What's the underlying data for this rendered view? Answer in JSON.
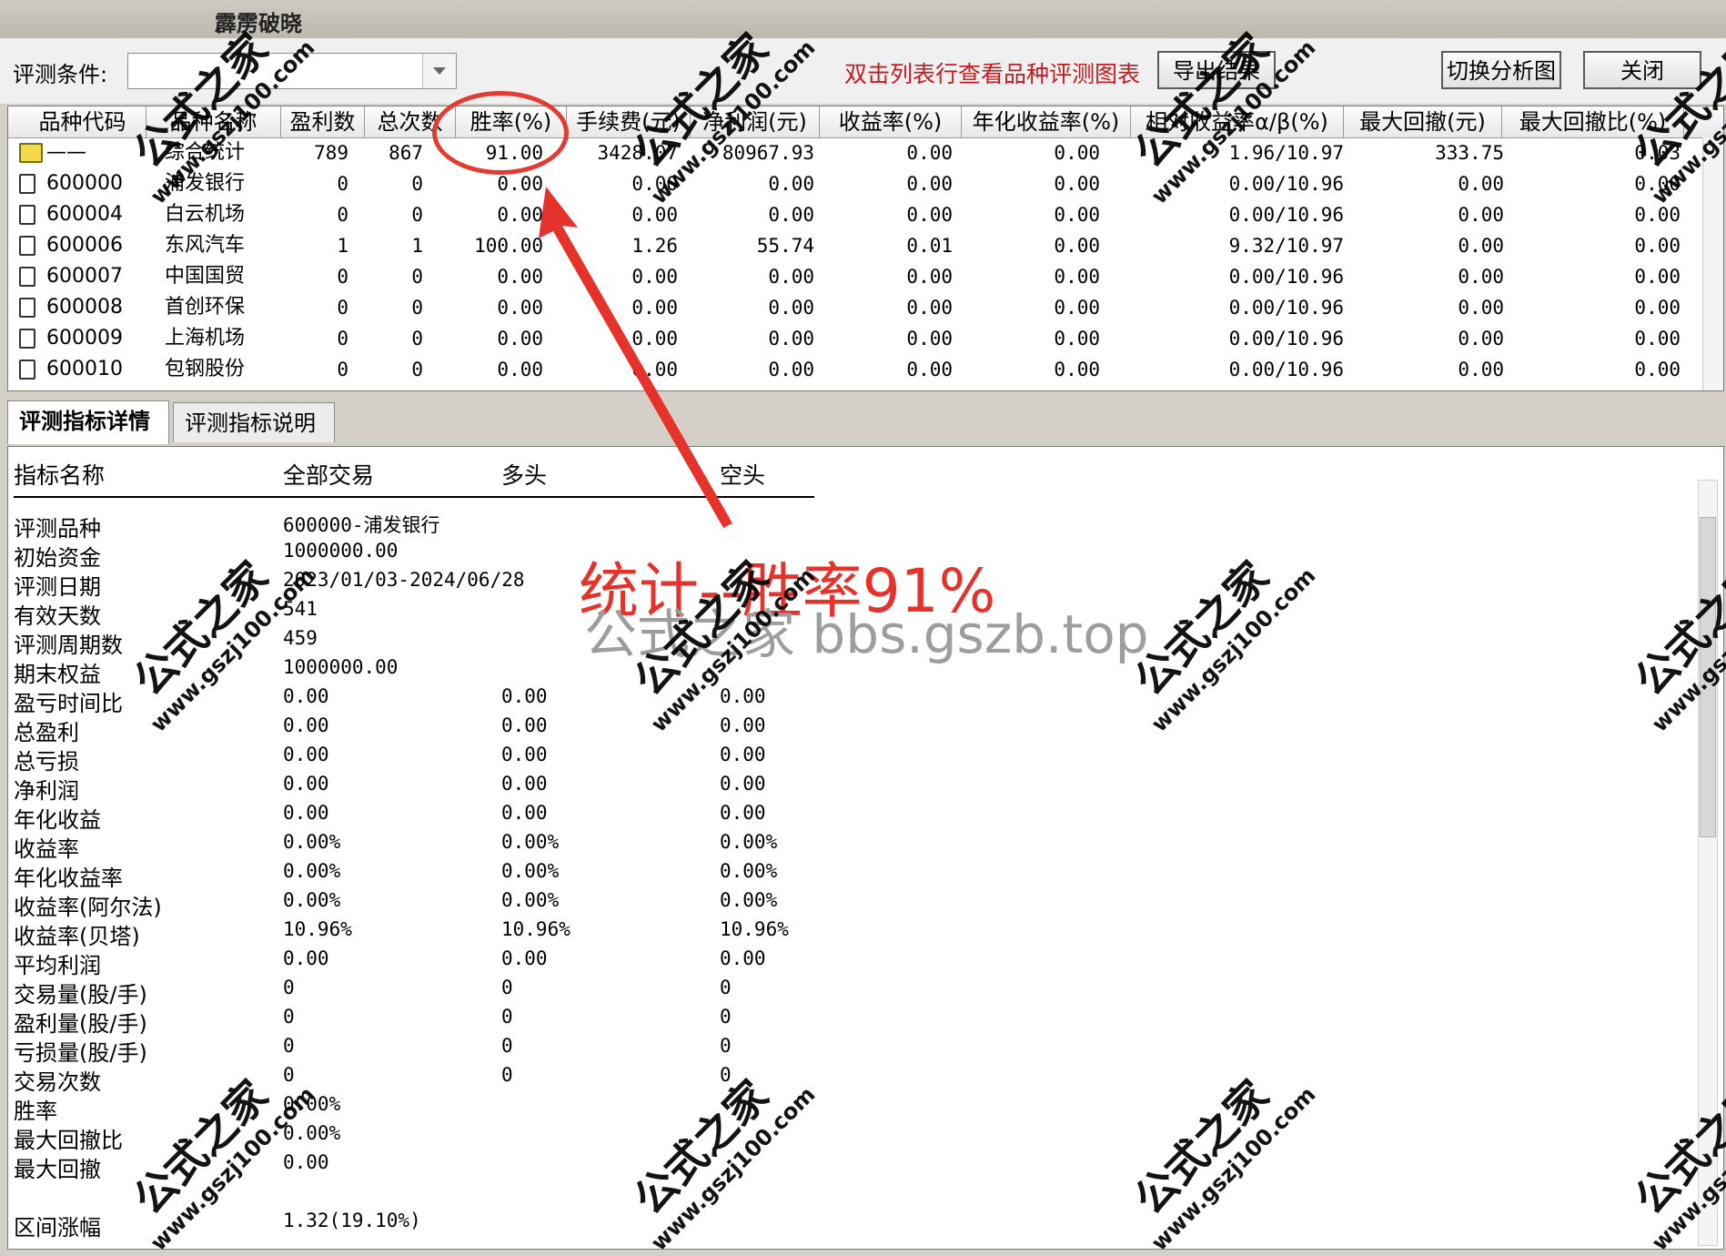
{
  "window": {
    "title": "霹雳破晓"
  },
  "toolbar": {
    "condition_label": "评测条件:",
    "condition_value": "",
    "hint": "双击列表行查看品种评测图表",
    "export_label": "导出结果",
    "switch_label": "切换分析图",
    "close_label": "关闭"
  },
  "grid": {
    "columns": [
      "品种代码",
      "品种名称",
      "盈利数",
      "总次数",
      "胜率(%)",
      "手续费(元)",
      "净利润(元)",
      "收益率(%)",
      "年化收益率(%)",
      "相对收益率α/β(%)",
      "最大回撤(元)",
      "最大回撤比(%)"
    ],
    "rows": [
      {
        "code": "——",
        "name": "综合统计",
        "win": "789",
        "total": "867",
        "rate": "91.00",
        "fee": "3428.07",
        "profit": "80967.93",
        "ret": "0.00",
        "annual": "0.00",
        "rel": "1.96/10.97",
        "dd": "333.75",
        "ddr": "0.03"
      },
      {
        "code": "600000",
        "name": "浦发银行",
        "win": "0",
        "total": "0",
        "rate": "0.00",
        "fee": "0.00",
        "profit": "0.00",
        "ret": "0.00",
        "annual": "0.00",
        "rel": "0.00/10.96",
        "dd": "0.00",
        "ddr": "0.00"
      },
      {
        "code": "600004",
        "name": "白云机场",
        "win": "0",
        "total": "0",
        "rate": "0.00",
        "fee": "0.00",
        "profit": "0.00",
        "ret": "0.00",
        "annual": "0.00",
        "rel": "0.00/10.96",
        "dd": "0.00",
        "ddr": "0.00"
      },
      {
        "code": "600006",
        "name": "东风汽车",
        "win": "1",
        "total": "1",
        "rate": "100.00",
        "fee": "1.26",
        "profit": "55.74",
        "ret": "0.01",
        "annual": "0.00",
        "rel": "9.32/10.97",
        "dd": "0.00",
        "ddr": "0.00"
      },
      {
        "code": "600007",
        "name": "中国国贸",
        "win": "0",
        "total": "0",
        "rate": "0.00",
        "fee": "0.00",
        "profit": "0.00",
        "ret": "0.00",
        "annual": "0.00",
        "rel": "0.00/10.96",
        "dd": "0.00",
        "ddr": "0.00"
      },
      {
        "code": "600008",
        "name": "首创环保",
        "win": "0",
        "total": "0",
        "rate": "0.00",
        "fee": "0.00",
        "profit": "0.00",
        "ret": "0.00",
        "annual": "0.00",
        "rel": "0.00/10.96",
        "dd": "0.00",
        "ddr": "0.00"
      },
      {
        "code": "600009",
        "name": "上海机场",
        "win": "0",
        "total": "0",
        "rate": "0.00",
        "fee": "0.00",
        "profit": "0.00",
        "ret": "0.00",
        "annual": "0.00",
        "rel": "0.00/10.96",
        "dd": "0.00",
        "ddr": "0.00"
      },
      {
        "code": "600010",
        "name": "包钢股份",
        "win": "0",
        "total": "0",
        "rate": "0.00",
        "fee": "0.00",
        "profit": "0.00",
        "ret": "0.00",
        "annual": "0.00",
        "rel": "0.00/10.96",
        "dd": "0.00",
        "ddr": "0.00"
      }
    ]
  },
  "tabs": [
    "评测指标详情",
    "评测指标说明"
  ],
  "detail": {
    "headers": [
      "指标名称",
      "全部交易",
      "多头",
      "空头"
    ],
    "rows": [
      [
        "评测品种",
        "600000-浦发银行",
        "",
        ""
      ],
      [
        "初始资金",
        "1000000.00",
        "",
        ""
      ],
      [
        "评测日期",
        "2023/01/03-2024/06/28",
        "",
        ""
      ],
      [
        "有效天数",
        "541",
        "",
        ""
      ],
      [
        "评测周期数",
        "459",
        "",
        ""
      ],
      [
        "期末权益",
        "1000000.00",
        "",
        ""
      ],
      [
        "盈亏时间比",
        "0.00",
        "0.00",
        "0.00"
      ],
      [
        "总盈利",
        "0.00",
        "0.00",
        "0.00"
      ],
      [
        "总亏损",
        "0.00",
        "0.00",
        "0.00"
      ],
      [
        "净利润",
        "0.00",
        "0.00",
        "0.00"
      ],
      [
        "年化收益",
        "0.00",
        "0.00",
        "0.00"
      ],
      [
        "收益率",
        "0.00%",
        "0.00%",
        "0.00%"
      ],
      [
        "年化收益率",
        "0.00%",
        "0.00%",
        "0.00%"
      ],
      [
        "收益率(阿尔法)",
        "0.00%",
        "0.00%",
        "0.00%"
      ],
      [
        "收益率(贝塔)",
        "10.96%",
        "10.96%",
        "10.96%"
      ],
      [
        "平均利润",
        "0.00",
        "0.00",
        "0.00"
      ],
      [
        "交易量(股/手)",
        "0",
        "0",
        "0"
      ],
      [
        "盈利量(股/手)",
        "0",
        "0",
        "0"
      ],
      [
        "亏损量(股/手)",
        "0",
        "0",
        "0"
      ],
      [
        "交易次数",
        "0",
        "0",
        "0"
      ],
      [
        "胜率",
        "0.00%",
        "",
        ""
      ],
      [
        "最大回撤比",
        "0.00%",
        "",
        ""
      ],
      [
        "最大回撤",
        "0.00",
        "",
        ""
      ],
      [
        "",
        "",
        " ",
        ""
      ],
      [
        "区间涨幅",
        "1.32(19.10%)",
        "",
        ""
      ]
    ]
  },
  "annotation": {
    "text": "统计--胜率91%",
    "sub": "公式之家 bbs.gszb.top"
  },
  "watermark": {
    "brand": "公式之家",
    "url": "www.gszj100.com"
  },
  "colors": {
    "hint": "#c8191e",
    "annotation": "#e5322b"
  }
}
